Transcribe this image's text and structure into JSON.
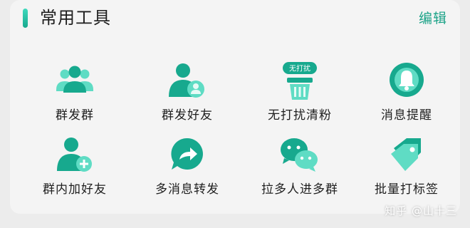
{
  "header": {
    "title": "常用工具",
    "edit_label": "编辑"
  },
  "tools": [
    {
      "label": "群发群",
      "icon": "group-broadcast-icon"
    },
    {
      "label": "群发好友",
      "icon": "friends-broadcast-icon"
    },
    {
      "label": "无打扰清粉",
      "icon": "no-disturb-clean-icon",
      "badge": "无打扰"
    },
    {
      "label": "消息提醒",
      "icon": "bell-icon"
    },
    {
      "label": "群内加好友",
      "icon": "add-friend-icon"
    },
    {
      "label": "多消息转发",
      "icon": "forward-icon"
    },
    {
      "label": "拉多人进多群",
      "icon": "chat-bubbles-icon"
    },
    {
      "label": "批量打标签",
      "icon": "tag-icon"
    }
  ],
  "watermark": "知乎 @山十三",
  "colors": {
    "accent": "#1da388",
    "icon_dark": "#17a98e",
    "icon_light": "#5fdcc4"
  }
}
